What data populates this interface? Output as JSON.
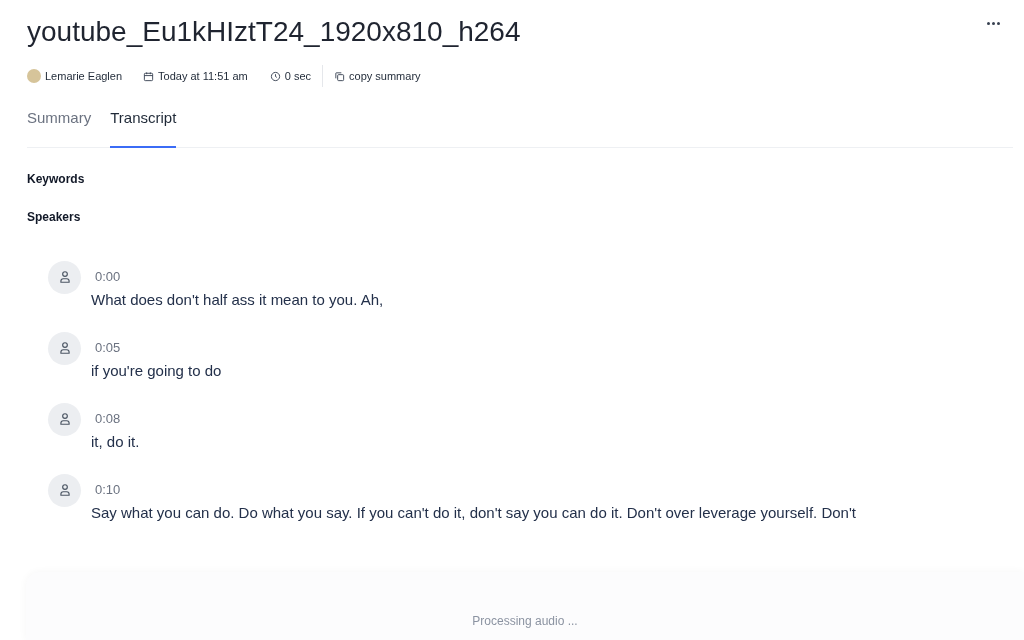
{
  "title": "youtube_Eu1kHIztT24_1920x810_h264",
  "meta": {
    "author": "Lemarie Eaglen",
    "date": "Today at 11:51 am",
    "duration": "0 sec",
    "copy": "copy summary"
  },
  "tabs": [
    {
      "label": "Summary",
      "selected": false
    },
    {
      "label": "Transcript",
      "selected": true
    }
  ],
  "sections": [
    "Keywords",
    "Speakers"
  ],
  "segments": [
    {
      "time": "0:00",
      "text": "What does don't half ass it mean to you. Ah,"
    },
    {
      "time": "0:05",
      "text": "if you're going to do"
    },
    {
      "time": "0:08",
      "text": "it, do it."
    },
    {
      "time": "0:10",
      "text": "Say what you can do. Do what you say. If you can't do it, don't say you can do it. Don't over leverage yourself. Don't"
    }
  ],
  "status": "Processing audio ..."
}
